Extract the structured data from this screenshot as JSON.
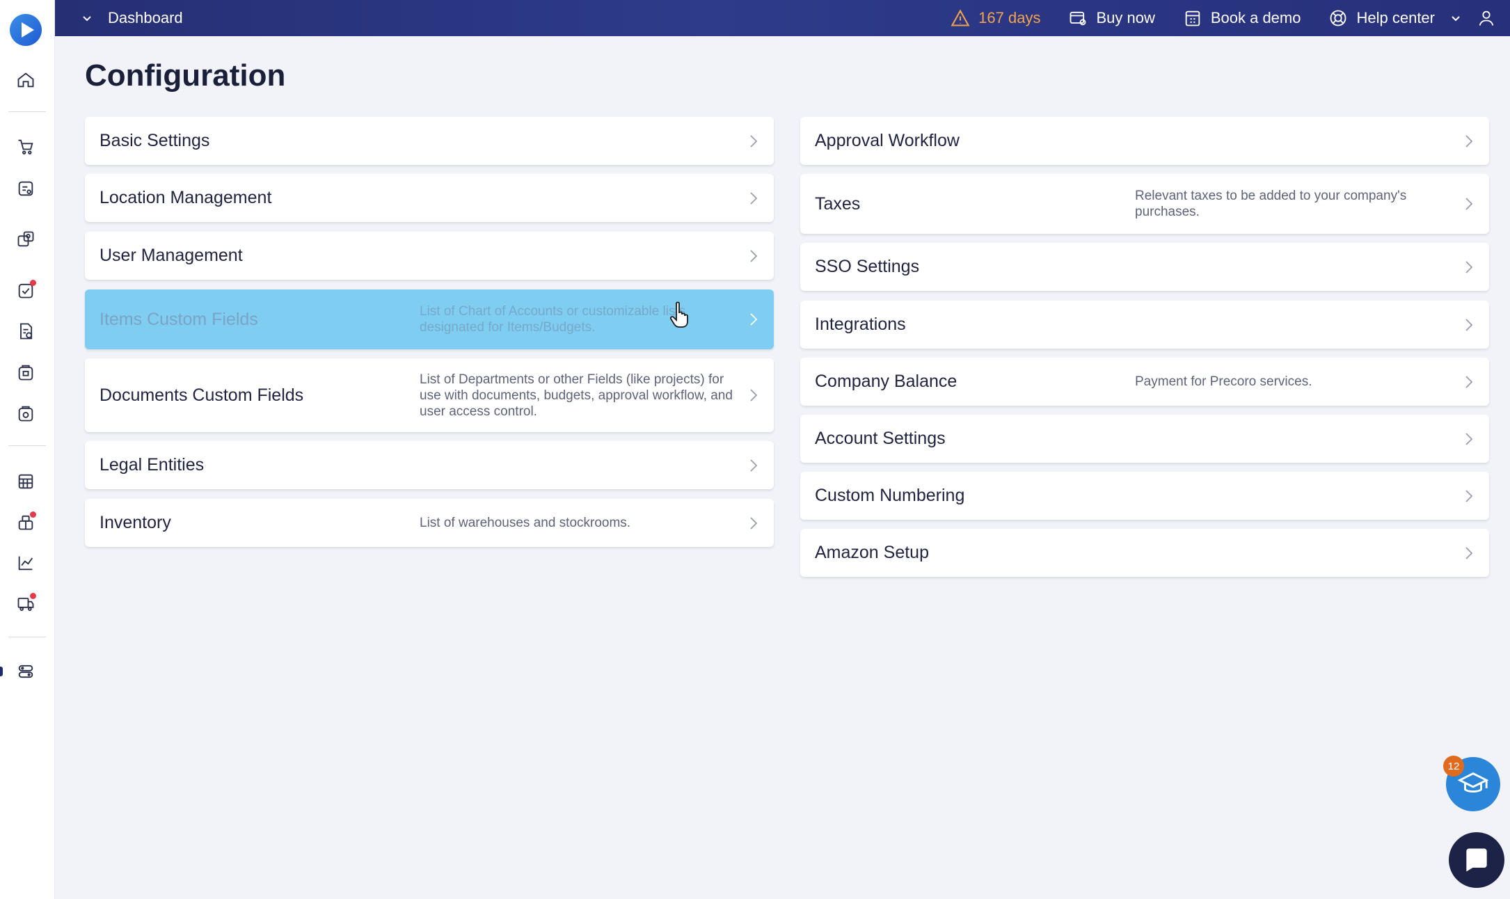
{
  "topbar": {
    "dashboard_label": "Dashboard",
    "trial_days": "167 days",
    "buy_now": "Buy now",
    "book_demo": "Book a demo",
    "help_center": "Help center"
  },
  "page": {
    "title": "Configuration"
  },
  "left_cards": [
    {
      "title": "Basic Settings",
      "description": ""
    },
    {
      "title": "Location Management",
      "description": ""
    },
    {
      "title": "User Management",
      "description": ""
    },
    {
      "title": "Items Custom Fields",
      "description": "List of Chart of Accounts or customizable lists designated for Items/Budgets."
    },
    {
      "title": "Documents Custom Fields",
      "description": "List of Departments or other Fields (like projects) for use with documents, budgets, approval workflow, and user access control."
    },
    {
      "title": "Legal Entities",
      "description": ""
    },
    {
      "title": "Inventory",
      "description": "List of warehouses and stockrooms."
    }
  ],
  "right_cards": [
    {
      "title": "Approval Workflow",
      "description": ""
    },
    {
      "title": "Taxes",
      "description": "Relevant taxes to be added to your company's purchases."
    },
    {
      "title": "SSO Settings",
      "description": ""
    },
    {
      "title": "Integrations",
      "description": ""
    },
    {
      "title": "Company Balance",
      "description": "Payment for Precoro services."
    },
    {
      "title": "Account Settings",
      "description": ""
    },
    {
      "title": "Custom Numbering",
      "description": ""
    },
    {
      "title": "Amazon Setup",
      "description": ""
    }
  ],
  "learn_badge": "12",
  "colors": {
    "topbar": "#2a3480",
    "active_card": "#7fcdf0",
    "trial_warning": "#f5a34b",
    "notification_dot": "#e23b4a"
  },
  "icons": {
    "sidebar": [
      "home-icon",
      "cart-icon",
      "request-icon",
      "supplier-icon",
      "approval-icon",
      "invoice-icon",
      "receipt-icon",
      "payment-icon",
      "budget-icon",
      "inventory-icon",
      "analytics-icon",
      "delivery-icon",
      "configuration-icon"
    ]
  }
}
